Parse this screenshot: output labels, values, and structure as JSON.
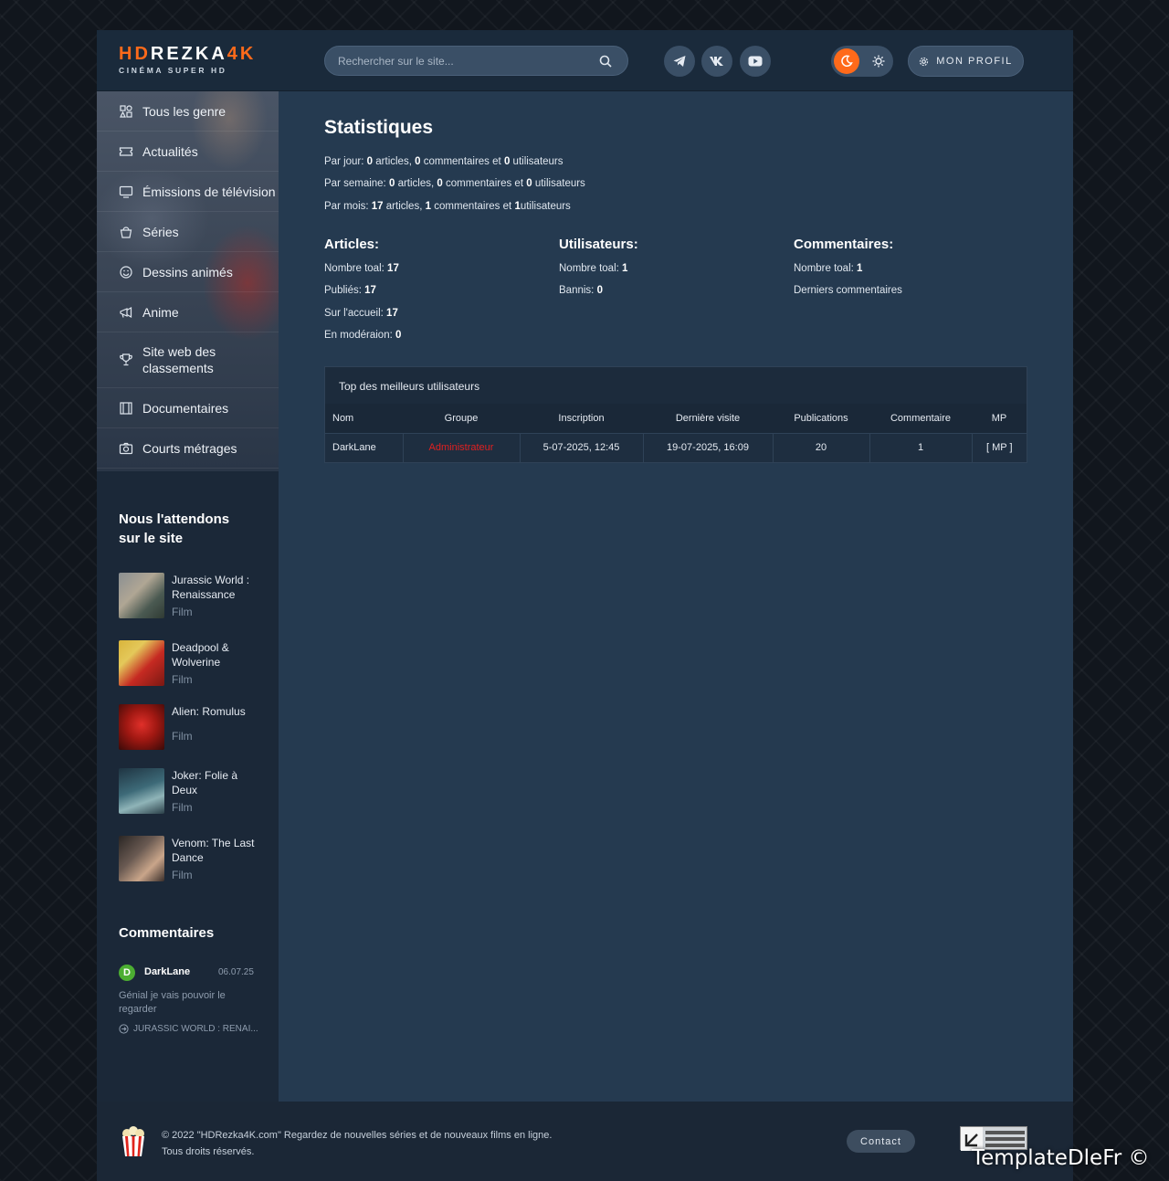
{
  "header": {
    "logo_main_a": "HD",
    "logo_main_b": "REZKA",
    "logo_main_c": "4K",
    "logo_sub": "CINÉMA SUPER HD",
    "search_placeholder": "Rechercher sur le site...",
    "profile_label": "MON PROFIL"
  },
  "nav": [
    {
      "label": "Tous les genre",
      "icon": "genre-icon"
    },
    {
      "label": "Actualités",
      "icon": "ticket-icon"
    },
    {
      "label": "Émissions de télévision",
      "icon": "tv-icon"
    },
    {
      "label": "Séries",
      "icon": "basket-icon"
    },
    {
      "label": "Dessins animés",
      "icon": "smile-icon"
    },
    {
      "label": "Anime",
      "icon": "megaphone-icon"
    },
    {
      "label": "Site web des classements",
      "icon": "trophy-icon"
    },
    {
      "label": "Documentaires",
      "icon": "film-icon"
    },
    {
      "label": "Courts métrages",
      "icon": "camera-icon"
    }
  ],
  "awaited": {
    "title": "Nous l'attendons sur le site",
    "items": [
      {
        "title": "Jurassic World : Renaissance",
        "genre": "Film"
      },
      {
        "title": "Deadpool & Wolverine",
        "genre": "Film"
      },
      {
        "title": "Alien: Romulus",
        "genre": "Film"
      },
      {
        "title": "Joker: Folie à Deux",
        "genre": "Film"
      },
      {
        "title": "Venom: The Last Dance",
        "genre": "Film"
      }
    ]
  },
  "comments": {
    "title": "Commentaires",
    "avatar_letter": "D",
    "author": "DarkLane",
    "date": "06.07.25",
    "text": "Génial je vais pouvoir le regarder",
    "link": "JURASSIC WORLD : RENAI..."
  },
  "stats": {
    "title": "Statistiques",
    "day": {
      "label": "Par jour:",
      "articles": "0",
      "comments": "0",
      "users": "0"
    },
    "week": {
      "label": "Par semaine:",
      "articles": "0",
      "comments": "0",
      "users": "0"
    },
    "month": {
      "label": "Par mois:",
      "articles": "17",
      "comments": "1",
      "users": "1"
    },
    "w_articles": "articles,",
    "w_comments": "commentaires et",
    "w_users": "utilisateurs",
    "articles": {
      "title": "Articles:",
      "total_label": "Nombre toal:",
      "total": "17",
      "published_label": "Publiés:",
      "published": "17",
      "home_label": "Sur l'accueil:",
      "home": "17",
      "moderation_label": "En modéraion:",
      "moderation": "0"
    },
    "users": {
      "title": "Utilisateurs:",
      "total_label": "Nombre toal:",
      "total": "1",
      "banned_label": "Bannis:",
      "banned": "0"
    },
    "comments": {
      "title": "Commentaires:",
      "total_label": "Nombre toal:",
      "total": "1",
      "last": "Derniers commentaires"
    }
  },
  "top_users": {
    "title": "Top des meilleurs utilisateurs",
    "headers": [
      "Nom",
      "Groupe",
      "Inscription",
      "Dernière visite",
      "Publications",
      "Commentaire",
      "MP"
    ],
    "row": [
      "DarkLane",
      "Administrateur",
      "5-07-2025, 12:45",
      "19-07-2025, 16:09",
      "20",
      "1",
      "[ MP ]"
    ]
  },
  "footer": {
    "line1": "© 2022 \"HDRezka4K.com\" Regardez de nouvelles séries et de nouveaux films en ligne.",
    "line2": "Tous droits réservés.",
    "contact": "Contact"
  },
  "watermark": "TemplateDleFr ©",
  "colors": {
    "accent": "#ff6a1a",
    "admin": "#e02020",
    "bg": "#253a50"
  }
}
